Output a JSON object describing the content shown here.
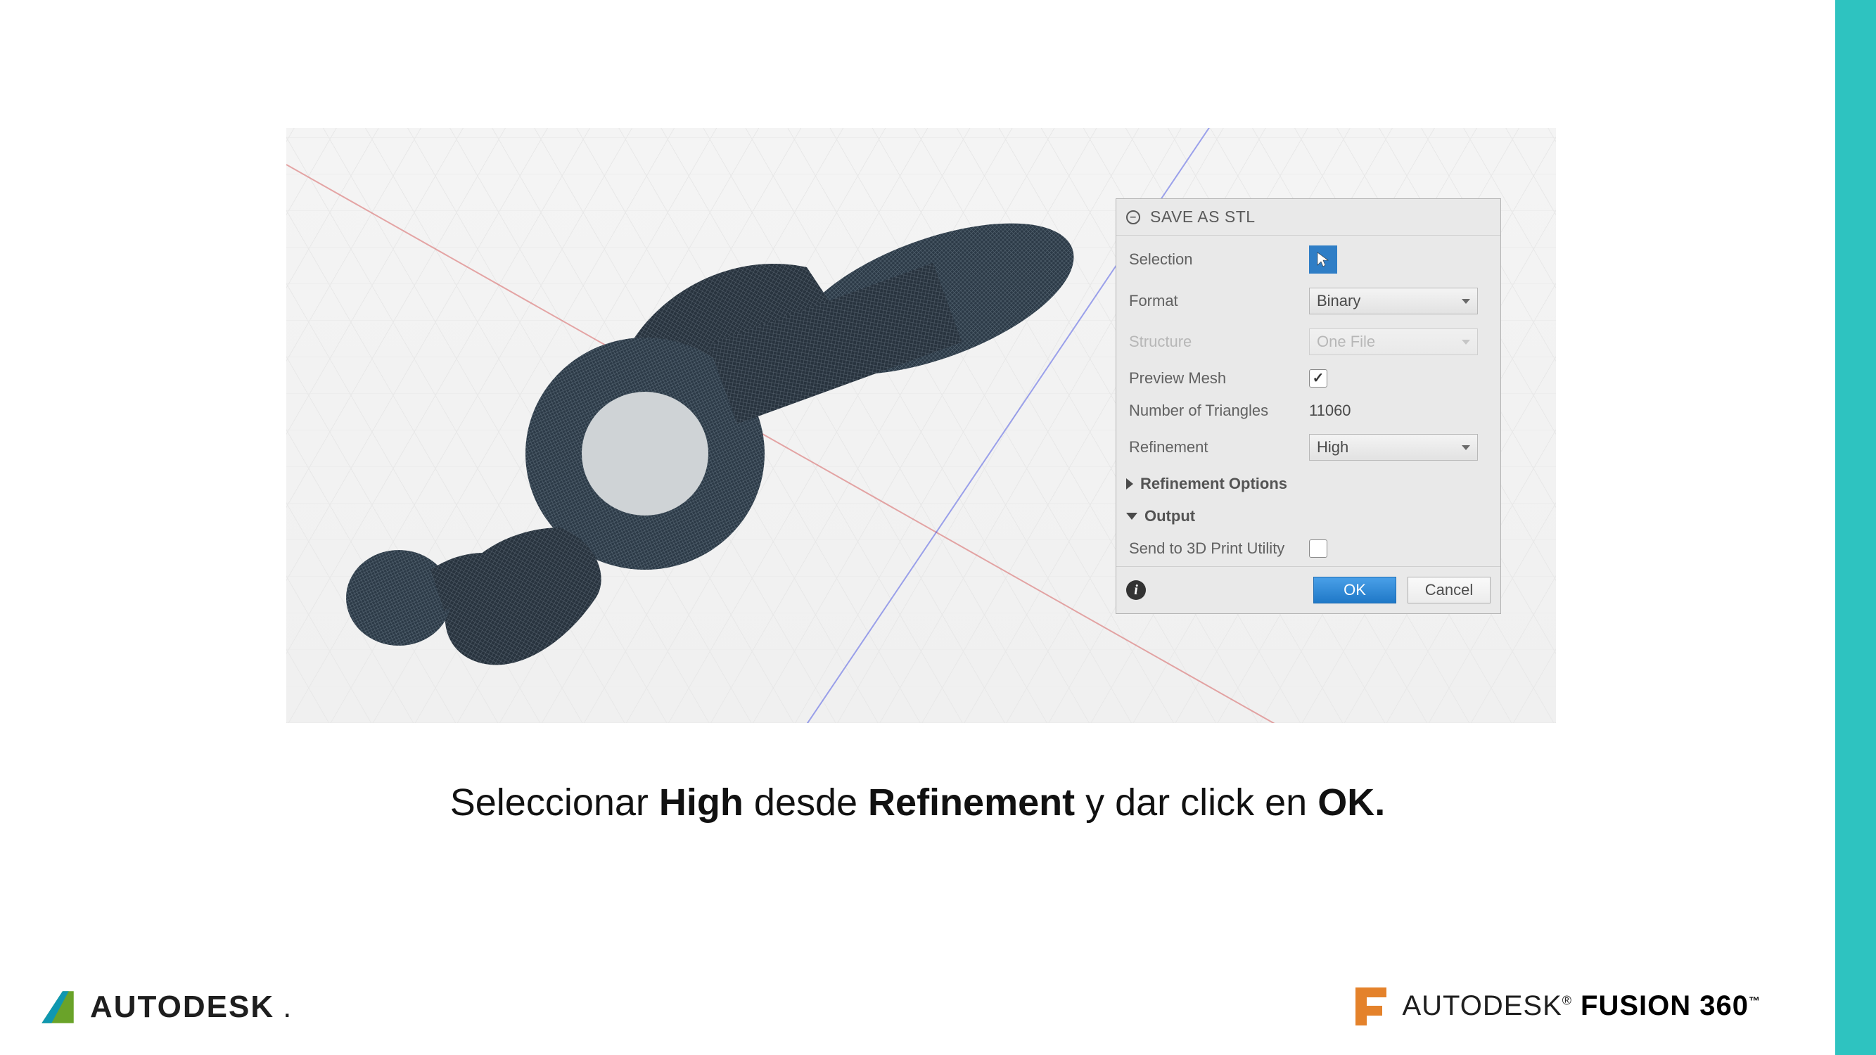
{
  "dialog": {
    "title": "SAVE AS STL",
    "selection_label": "Selection",
    "format_label": "Format",
    "format_value": "Binary",
    "structure_label": "Structure",
    "structure_value": "One File",
    "preview_label": "Preview Mesh",
    "triangles_label": "Number of Triangles",
    "triangles_value": "11060",
    "refinement_label": "Refinement",
    "refinement_value": "High",
    "refinement_options_label": "Refinement Options",
    "output_label": "Output",
    "send3d_label": "Send to 3D Print Utility",
    "ok_label": "OK",
    "cancel_label": "Cancel"
  },
  "caption": {
    "p1": "Seleccionar ",
    "b1": "High",
    "p2": " desde ",
    "b2": "Refinement",
    "p3": " y dar click en ",
    "b3": "OK."
  },
  "logos": {
    "autodesk": "AUTODESK",
    "autodesk2": "AUTODESK",
    "fusion": "FUSION 360"
  }
}
